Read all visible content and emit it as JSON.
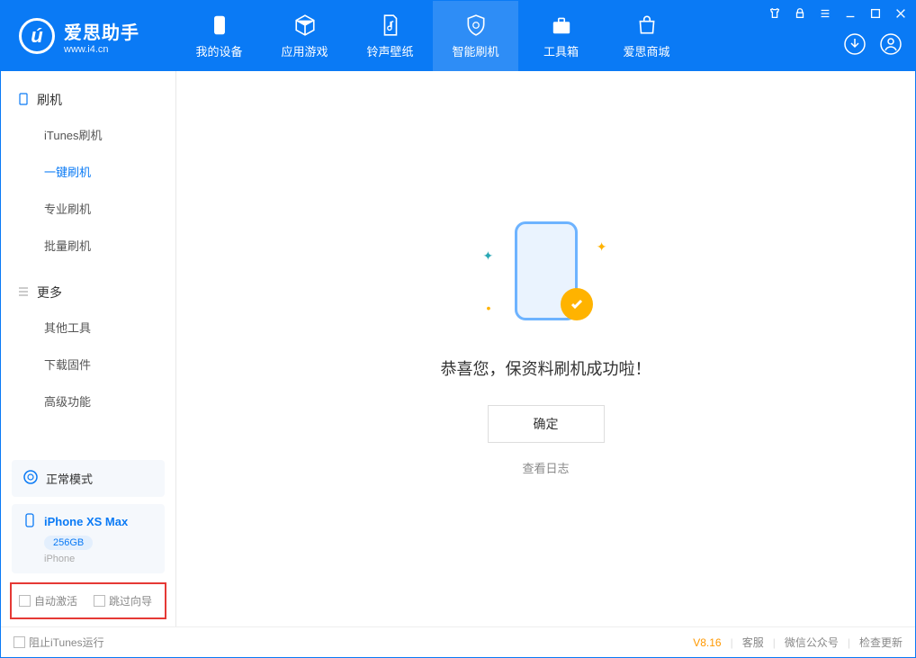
{
  "app": {
    "title": "爱思助手",
    "subtitle": "www.i4.cn"
  },
  "nav": {
    "items": [
      {
        "label": "我的设备"
      },
      {
        "label": "应用游戏"
      },
      {
        "label": "铃声壁纸"
      },
      {
        "label": "智能刷机"
      },
      {
        "label": "工具箱"
      },
      {
        "label": "爱思商城"
      }
    ]
  },
  "sidebar": {
    "section1_title": "刷机",
    "section1_items": [
      {
        "label": "iTunes刷机"
      },
      {
        "label": "一键刷机"
      },
      {
        "label": "专业刷机"
      },
      {
        "label": "批量刷机"
      }
    ],
    "section2_title": "更多",
    "section2_items": [
      {
        "label": "其他工具"
      },
      {
        "label": "下载固件"
      },
      {
        "label": "高级功能"
      }
    ],
    "mode_label": "正常模式",
    "device_name": "iPhone XS Max",
    "device_capacity": "256GB",
    "device_type": "iPhone",
    "chk_auto_activate": "自动激活",
    "chk_skip_guide": "跳过向导"
  },
  "main": {
    "success_text": "恭喜您，保资料刷机成功啦！",
    "ok_button": "确定",
    "view_log": "查看日志"
  },
  "statusbar": {
    "block_itunes": "阻止iTunes运行",
    "version": "V8.16",
    "link_support": "客服",
    "link_wechat": "微信公众号",
    "link_update": "检查更新"
  }
}
